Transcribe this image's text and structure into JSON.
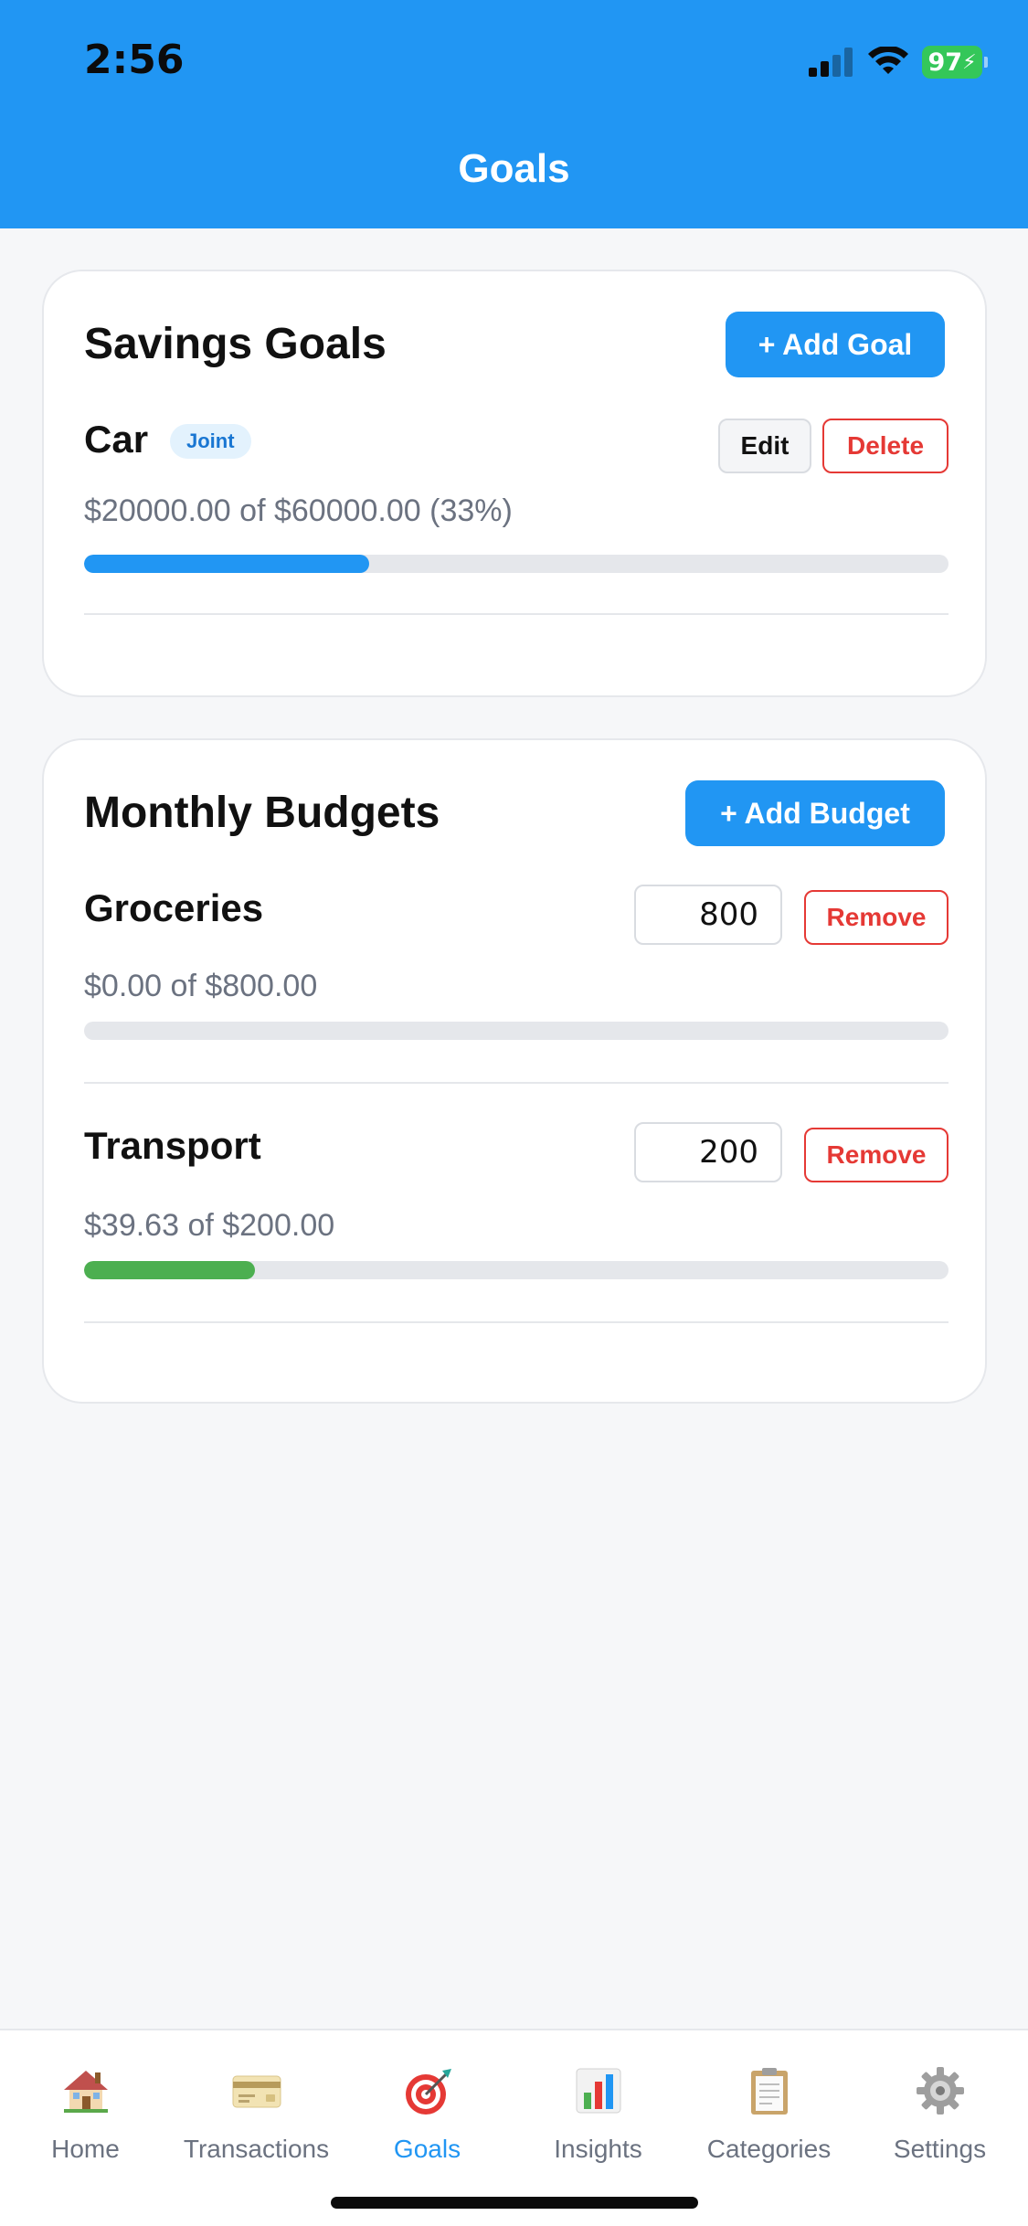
{
  "status_bar": {
    "time": "2:56",
    "battery": "97"
  },
  "header": {
    "title": "Goals"
  },
  "savings": {
    "title": "Savings Goals",
    "add_label": "+ Add Goal",
    "goals": [
      {
        "name": "Car",
        "badge": "Joint",
        "progress_text": "$20000.00 of $60000.00 (33%)",
        "progress": 0.33,
        "edit_label": "Edit",
        "delete_label": "Delete"
      }
    ]
  },
  "budgets": {
    "title": "Monthly Budgets",
    "add_label": "+ Add Budget",
    "items": [
      {
        "name": "Groceries",
        "input_value": "800",
        "remove_label": "Remove",
        "progress_text": "$0.00 of $800.00",
        "progress": 0.0
      },
      {
        "name": "Transport",
        "input_value": "200",
        "remove_label": "Remove",
        "progress_text": "$39.63 of $200.00",
        "progress": 0.198
      }
    ]
  },
  "colors": {
    "accent": "#2196f3",
    "progress_savings": "#2196f3",
    "progress_budget": "#4caf50",
    "danger": "#e53935",
    "battery": "#34c759"
  },
  "tabs": [
    {
      "label": "Home",
      "icon": "house-icon",
      "active": false
    },
    {
      "label": "Transactions",
      "icon": "credit-card-icon",
      "active": false
    },
    {
      "label": "Goals",
      "icon": "target-icon",
      "active": true
    },
    {
      "label": "Insights",
      "icon": "bar-chart-icon",
      "active": false
    },
    {
      "label": "Categories",
      "icon": "clipboard-icon",
      "active": false
    },
    {
      "label": "Settings",
      "icon": "gear-icon",
      "active": false
    }
  ]
}
